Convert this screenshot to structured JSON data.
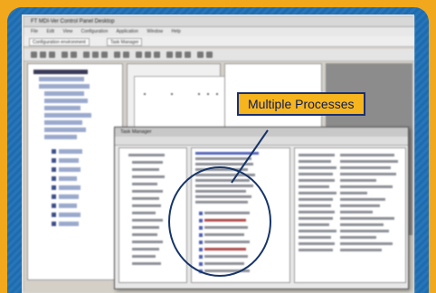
{
  "window": {
    "title": "FT MDI-Ver Control Panel Desktop",
    "menu": [
      "File",
      "Edit",
      "View",
      "Configuration",
      "Application",
      "Window",
      "Help"
    ],
    "tabs": [
      "Configuration environment",
      "Task Manager"
    ]
  },
  "task_manager": {
    "title": "Task Manager"
  },
  "annotation": {
    "label": "Multiple Processes"
  },
  "colors": {
    "frame": "#f2a81c",
    "background": "#1f6fb5",
    "callout_fill": "#f6b51d",
    "callout_border": "#1a2f6e",
    "circle": "#173568"
  }
}
